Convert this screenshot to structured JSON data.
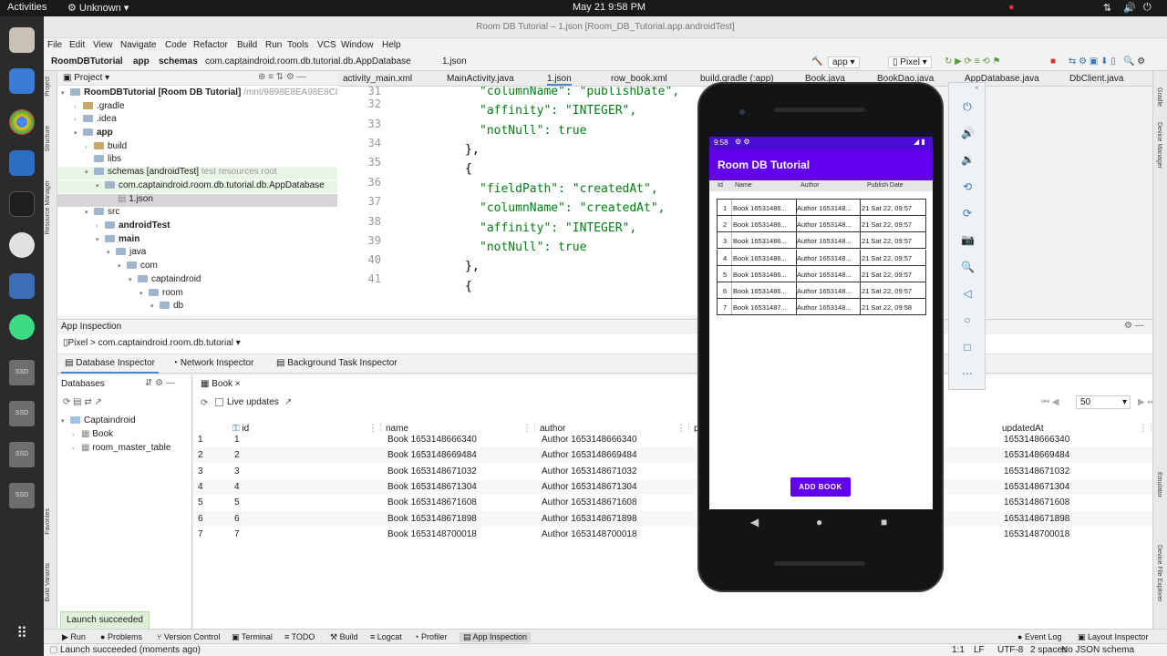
{
  "gnome": {
    "activities": "Activities",
    "app": "Unknown",
    "clock": "May 21  9:58 PM"
  },
  "window_title": "Room DB Tutorial – 1.json [Room_DB_Tutorial.app.androidTest]",
  "menu": [
    "File",
    "Edit",
    "View",
    "Navigate",
    "Code",
    "Refactor",
    "Build",
    "Run",
    "Tools",
    "VCS",
    "Window",
    "Help"
  ],
  "breadcrumb": [
    "RoomDBTutorial",
    "app",
    "schemas",
    "com.captaindroid.room.db.tutorial.db.AppDatabase",
    "1.json"
  ],
  "run_config": {
    "module": "app",
    "device": "Pixel"
  },
  "project_panel": {
    "title": "Project",
    "tree": [
      {
        "label": "RoomDBTutorial [Room DB Tutorial]",
        "hint": "/mnt/9898E8EA98E8C8",
        "indent": 0
      },
      {
        "label": ".gradle",
        "indent": 1
      },
      {
        "label": ".idea",
        "indent": 1
      },
      {
        "label": "app",
        "indent": 1
      },
      {
        "label": "build",
        "indent": 2
      },
      {
        "label": "libs",
        "indent": 2
      },
      {
        "label": "schemas [androidTest]",
        "hint": "test resources root",
        "indent": 2
      },
      {
        "label": "com.captaindroid.room.db.tutorial.db.AppDatabase",
        "indent": 3
      },
      {
        "label": "1.json",
        "indent": 4
      },
      {
        "label": "src",
        "indent": 2
      },
      {
        "label": "androidTest",
        "indent": 3
      },
      {
        "label": "main",
        "indent": 3
      },
      {
        "label": "java",
        "indent": 4
      },
      {
        "label": "com",
        "indent": 5
      },
      {
        "label": "captaindroid",
        "indent": 6
      },
      {
        "label": "room",
        "indent": 7
      },
      {
        "label": "db",
        "indent": 8
      }
    ]
  },
  "editor_tabs": [
    "activity_main.xml",
    "MainActivity.java",
    "1.json",
    "row_book.xml",
    "build.gradle (:app)",
    "Book.java",
    "BookDao.java",
    "AppDatabase.java",
    "DbClient.java"
  ],
  "code": [
    {
      "n": "",
      "t": "\"columnName\": \"publishDate\","
    },
    {
      "n": "32",
      "t": "\"affinity\": \"INTEGER\","
    },
    {
      "n": "33",
      "t": "\"notNull\": true"
    },
    {
      "n": "34",
      "t": "},"
    },
    {
      "n": "35",
      "t": "{"
    },
    {
      "n": "36",
      "t": "\"fieldPath\": \"createdAt\","
    },
    {
      "n": "37",
      "t": "\"columnName\": \"createdAt\","
    },
    {
      "n": "38",
      "t": "\"affinity\": \"INTEGER\","
    },
    {
      "n": "39",
      "t": "\"notNull\": true"
    },
    {
      "n": "40",
      "t": "},"
    },
    {
      "n": "41",
      "t": "{"
    }
  ],
  "inspection": {
    "title": "App Inspection",
    "process": "Pixel > com.captaindroid.room.db.tutorial",
    "tabs": [
      "Database Inspector",
      "Network Inspector",
      "Background Task Inspector"
    ],
    "databases_label": "Databases",
    "db_name": "Captaindroid",
    "tables": [
      "Book",
      "room_master_table"
    ],
    "open_table": "Book",
    "live_updates": "Live updates",
    "page_size": "50",
    "columns": [
      "id",
      "name",
      "author",
      "p",
      "updatedAt"
    ],
    "rows": [
      [
        "1",
        "1",
        "Book 1653148666340",
        "Author 1653148666340",
        "1653148666340"
      ],
      [
        "2",
        "2",
        "Book 1653148669484",
        "Author 1653148669484",
        "1653148669484"
      ],
      [
        "3",
        "3",
        "Book 1653148671032",
        "Author 1653148671032",
        "1653148671032"
      ],
      [
        "4",
        "4",
        "Book 1653148671304",
        "Author 1653148671304",
        "1653148671304"
      ],
      [
        "5",
        "5",
        "Book 1653148671608",
        "Author 1653148671608",
        "1653148671608"
      ],
      [
        "6",
        "6",
        "Book 1653148671898",
        "Author 1653148671898",
        "1653148671898"
      ],
      [
        "7",
        "7",
        "Book 1653148700018",
        "Author 1653148700018",
        "1653148700018"
      ]
    ]
  },
  "phone": {
    "time": "9:58",
    "app_title": "Room DB Tutorial",
    "headers": [
      "Id",
      "Name",
      "Author",
      "Publish Date"
    ],
    "rows": [
      [
        "1",
        "Book 16531486...",
        "Author 1653148...",
        "21 Sat 22, 09:57"
      ],
      [
        "2",
        "Book 16531486...",
        "Author 1653148...",
        "21 Sat 22, 09:57"
      ],
      [
        "3",
        "Book 16531486...",
        "Author 1653148...",
        "21 Sat 22, 09:57"
      ],
      [
        "4",
        "Book 16531486...",
        "Author 1653148...",
        "21 Sat 22, 09:57"
      ],
      [
        "5",
        "Book 16531486...",
        "Author 1653148...",
        "21 Sat 22, 09:57"
      ],
      [
        "6",
        "Book 16531486...",
        "Author 1653148...",
        "21 Sat 22, 09:57"
      ],
      [
        "7",
        "Book 16531487...",
        "Author 1653148...",
        "21 Sat 22, 09:58"
      ]
    ],
    "button": "ADD BOOK"
  },
  "toast": "Launch succeeded",
  "bottom_tabs": [
    "Run",
    "Problems",
    "Version Control",
    "Terminal",
    "TODO",
    "Build",
    "Logcat",
    "Profiler",
    "App Inspection",
    "Event Log",
    "Layout Inspector"
  ],
  "status": {
    "message": "Launch succeeded (moments ago)",
    "position": "1:1",
    "lf": "LF",
    "enc": "UTF-8",
    "indent": "2 spaces",
    "schema": "No JSON schema"
  },
  "side_strips": {
    "left": [
      "Project",
      "Structure",
      "Resource Manager",
      "Favorites",
      "Build Variants"
    ],
    "right": [
      "Gradle",
      "Device Manager",
      "Emulator",
      "Device File Explorer"
    ]
  },
  "colors": {
    "accent": "#6200ee",
    "status_purple": "#4a0dd3",
    "string_green": "#067d17"
  }
}
